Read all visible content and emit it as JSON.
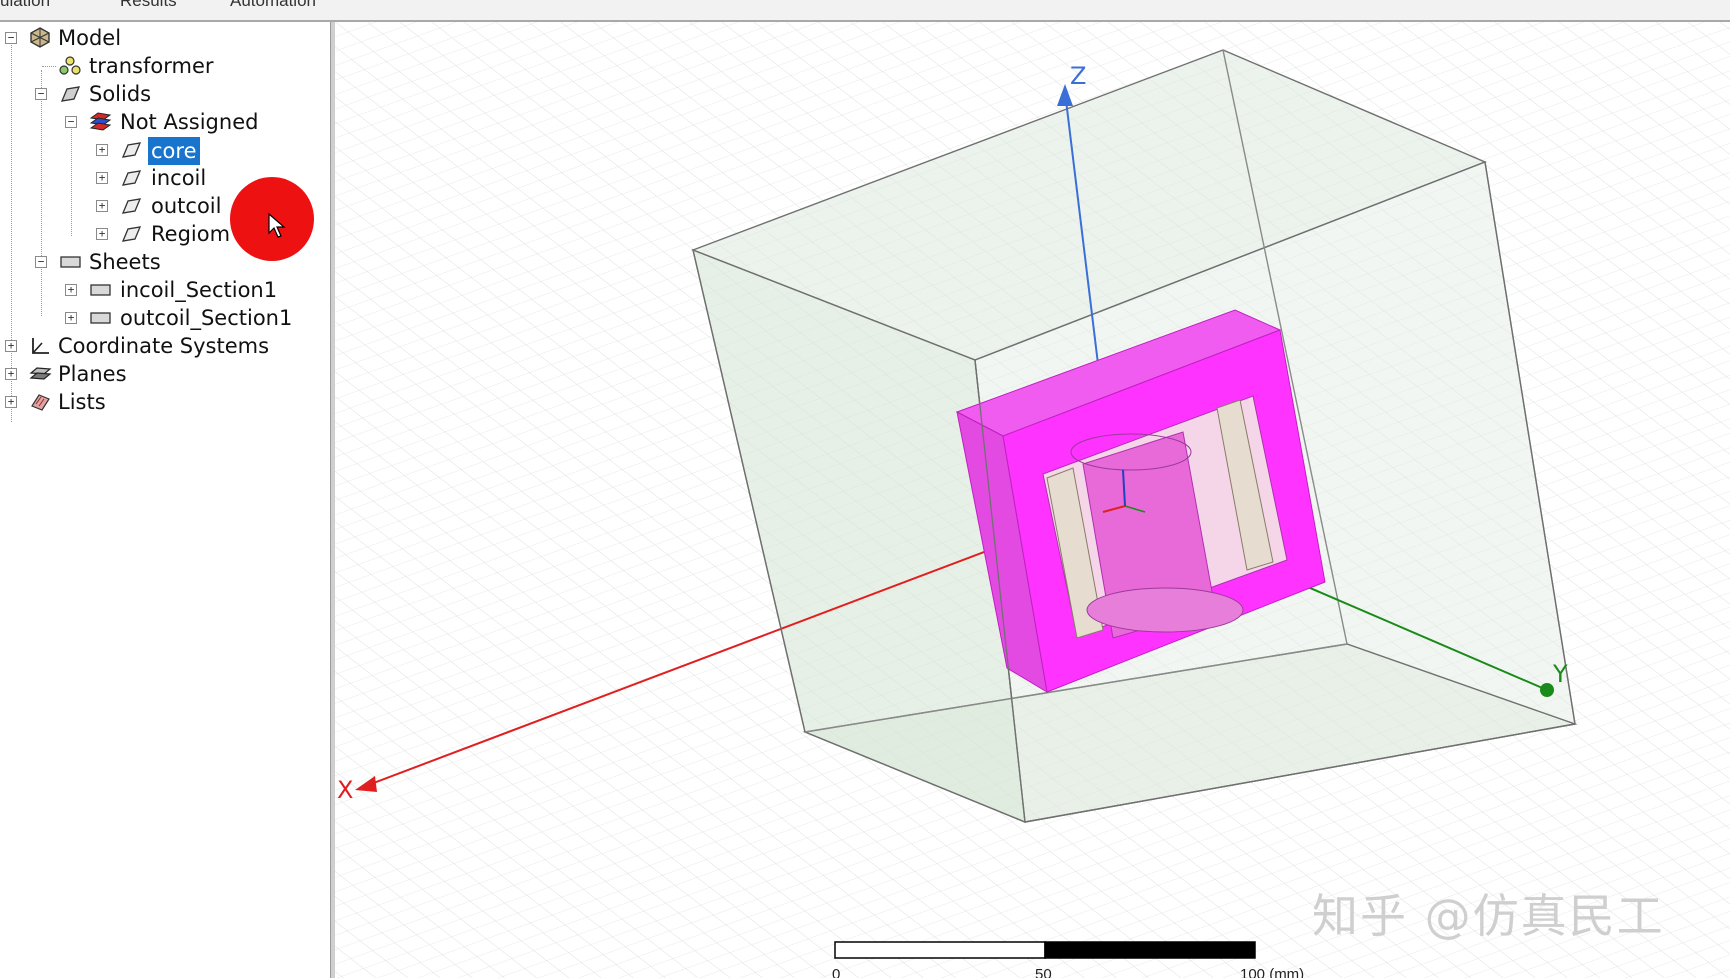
{
  "menubar": {
    "items": [
      "ulation",
      "Results",
      "Automation"
    ]
  },
  "tree": {
    "model": "Model",
    "transformer": "transformer",
    "solids": "Solids",
    "not_assigned": "Not Assigned",
    "core": "core",
    "incoil": "incoil",
    "outcoil": "outcoil",
    "regiom": "Regiom",
    "sheets": "Sheets",
    "incoil_section": "incoil_Section1",
    "outcoil_section": "outcoil_Section1",
    "coordinate_systems": "Coordinate Systems",
    "planes": "Planes",
    "lists": "Lists"
  },
  "axes": {
    "x": "X",
    "y": "Y",
    "z": "Z"
  },
  "scale": {
    "tick0": "0",
    "tick1": "50",
    "tick2": "100 (mm)"
  },
  "watermark": "知乎 @仿真民工",
  "colors": {
    "selection": "#1874cd",
    "core": "#ff33ff",
    "x_axis": "#e02020",
    "y_axis": "#1a8a1a",
    "z_axis": "#3a6fd8",
    "region": "#d8e8d8"
  }
}
